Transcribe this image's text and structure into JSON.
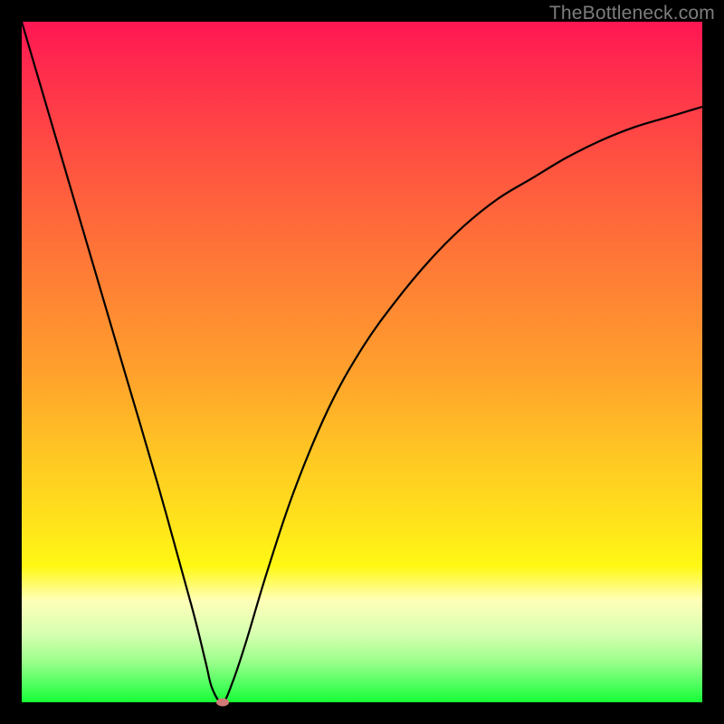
{
  "watermark": "TheBottleneck.com",
  "colors": {
    "frame": "#000000",
    "curve": "#000000",
    "marker": "#cf7a77",
    "gradient_top": "#ff1653",
    "gradient_bottom": "#15fd35"
  },
  "chart_data": {
    "type": "line",
    "title": "",
    "xlabel": "",
    "ylabel": "",
    "xlim": [
      0,
      100
    ],
    "ylim": [
      0,
      100
    ],
    "grid": false,
    "legend": false,
    "series": [
      {
        "name": "bottleneck-curve",
        "x": [
          0,
          5,
          10,
          15,
          20,
          25,
          27,
          28,
          29.5,
          31,
          33,
          36,
          40,
          45,
          50,
          55,
          60,
          65,
          70,
          75,
          80,
          85,
          90,
          95,
          100
        ],
        "values": [
          100,
          83,
          66,
          49,
          32,
          14,
          6,
          2,
          0,
          3,
          9,
          19,
          31,
          43,
          52,
          59,
          65,
          70,
          74,
          77,
          80,
          82.5,
          84.5,
          86,
          87.5
        ]
      }
    ],
    "annotations": [
      {
        "name": "minimum-marker",
        "x": 29.5,
        "y": 0
      }
    ],
    "background_gradient": {
      "direction": "vertical",
      "stops": [
        {
          "pos": 0.0,
          "color": "#ff1653"
        },
        {
          "pos": 0.5,
          "color": "#ffa22c"
        },
        {
          "pos": 0.8,
          "color": "#fff814"
        },
        {
          "pos": 1.0,
          "color": "#15fd35"
        }
      ]
    }
  }
}
